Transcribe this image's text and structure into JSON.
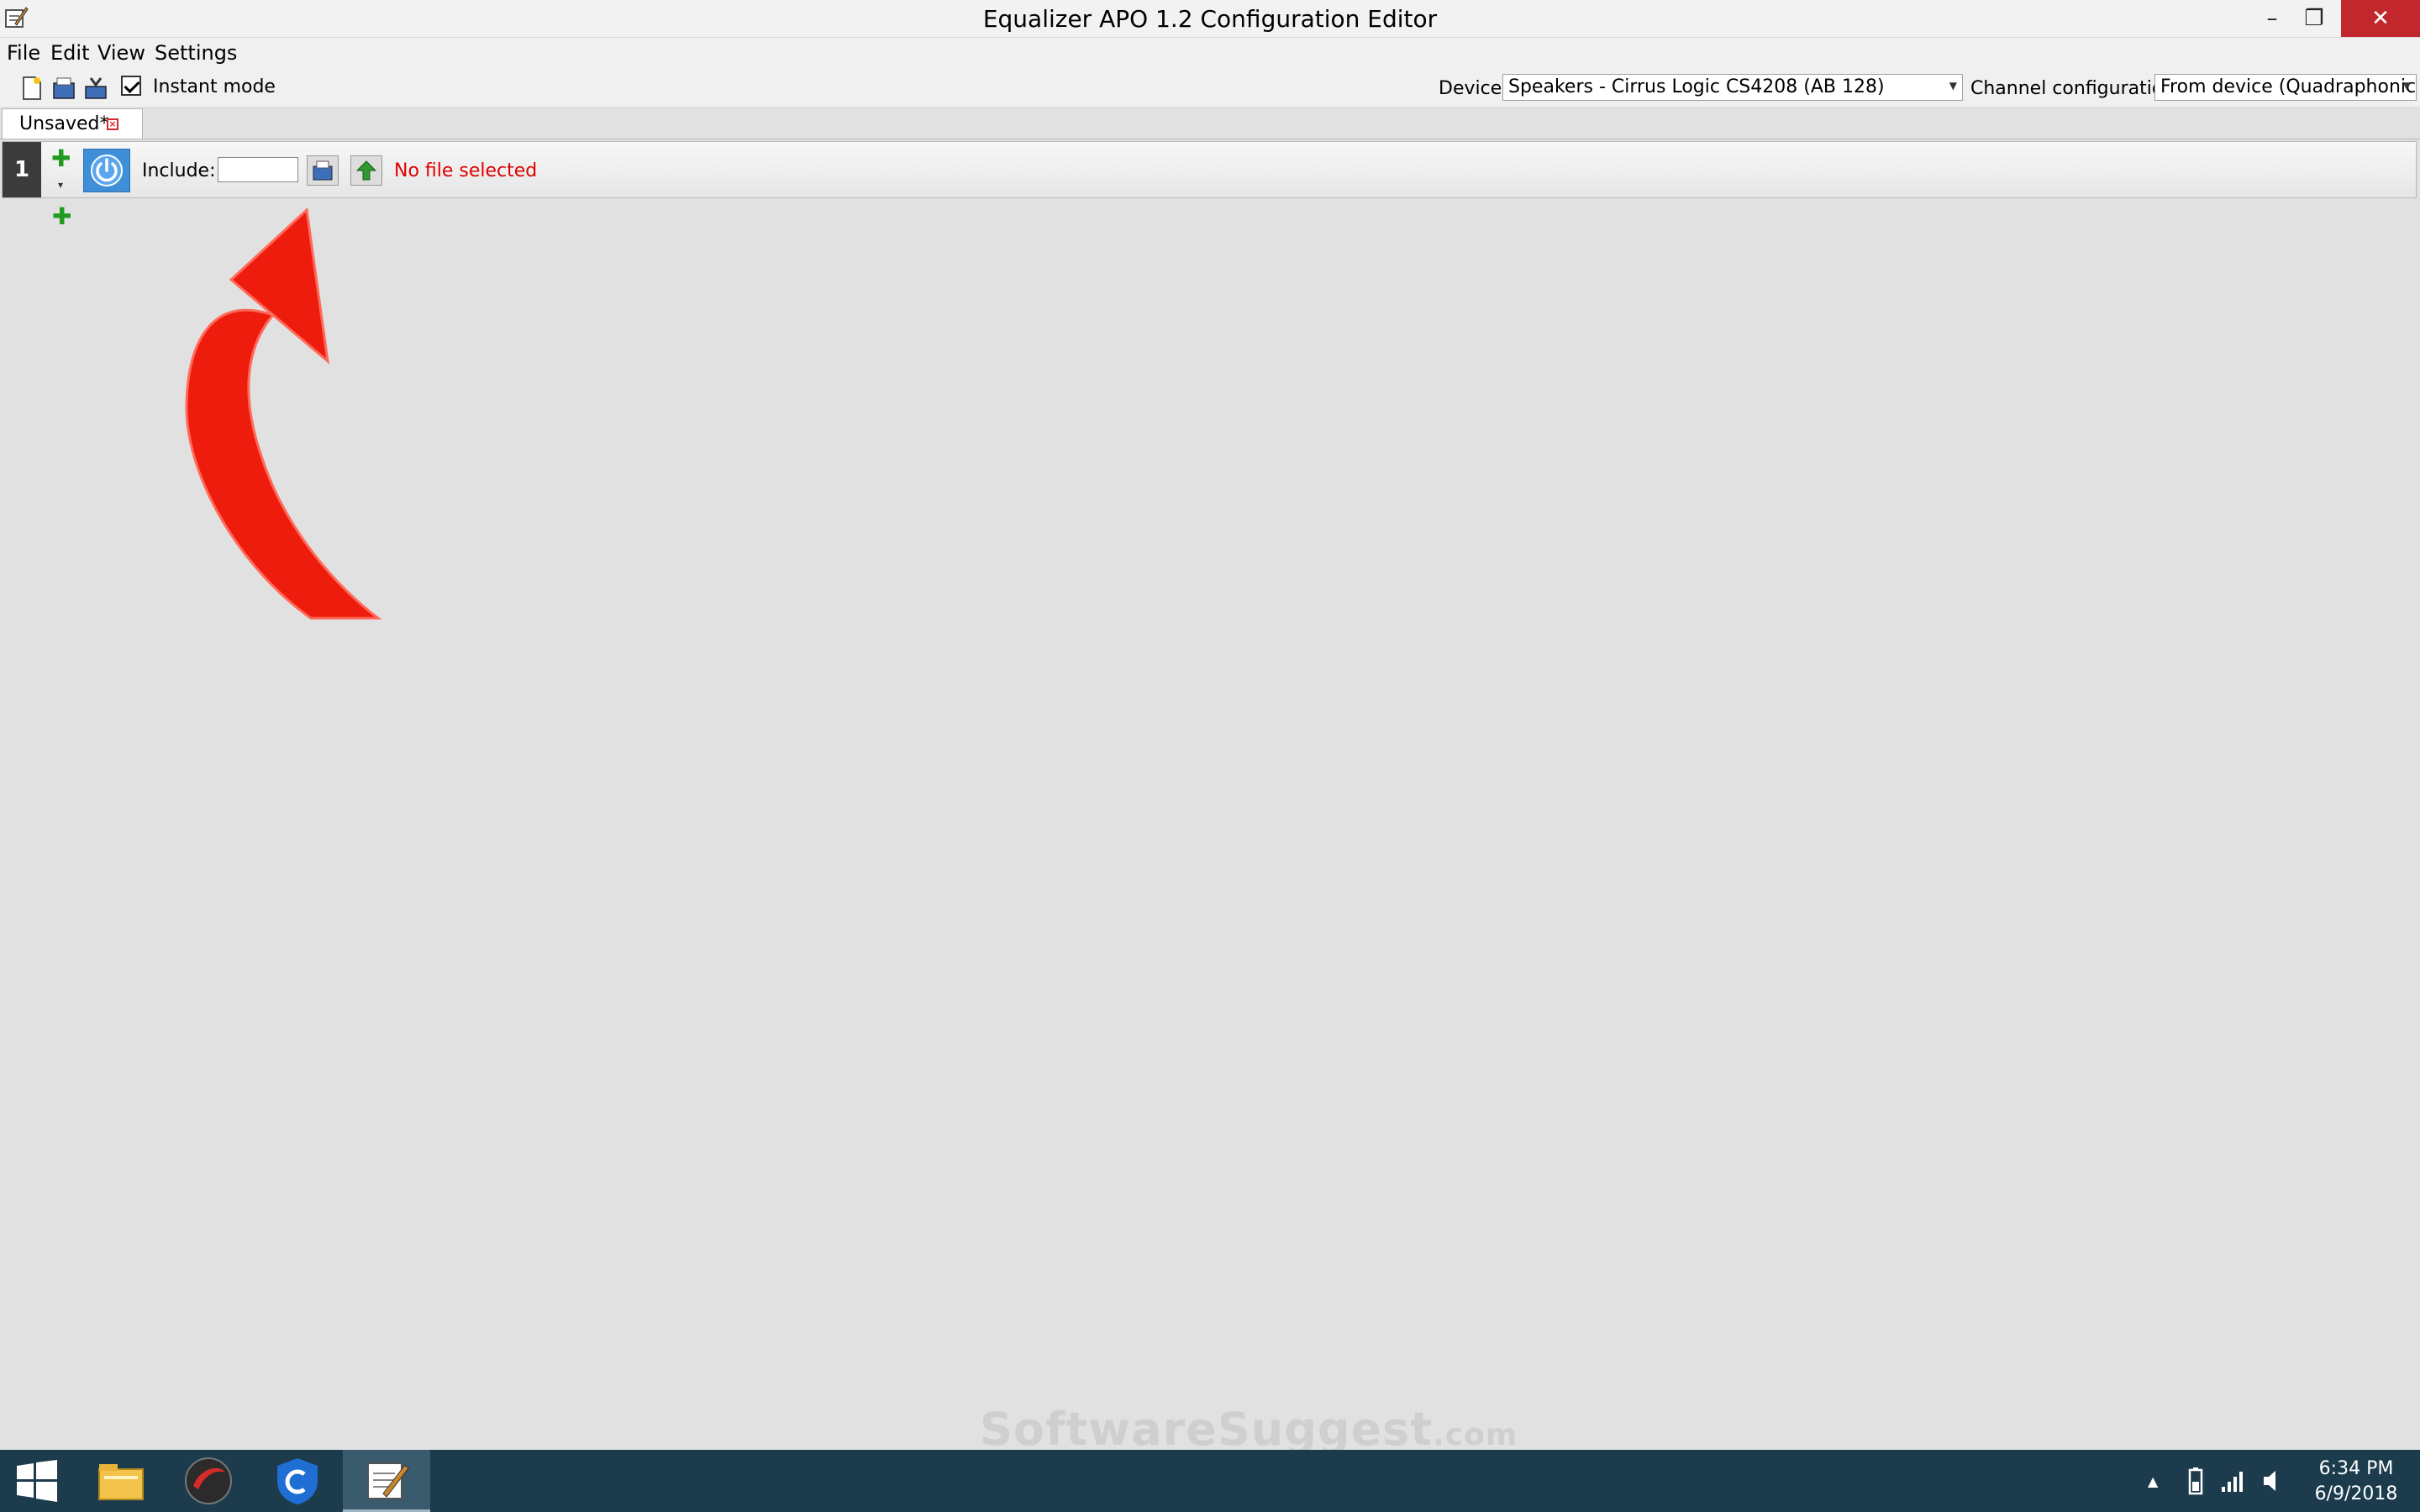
{
  "window": {
    "title": "Equalizer APO 1.2 Configuration Editor",
    "minimize_glyph": "–",
    "maximize_glyph": "❐",
    "close_glyph": "✕"
  },
  "menu": {
    "items": [
      "File",
      "Edit",
      "View",
      "Settings"
    ]
  },
  "toolbar": {
    "instant_mode_label": "Instant mode",
    "instant_mode_checked": true,
    "device_label": "Device:",
    "device_value": "Speakers - Cirrus Logic CS4208 (AB 128)",
    "channel_label": "Channel configuration:",
    "channel_value": "From device (Quadraphonic)"
  },
  "tabs": [
    {
      "label": "Unsaved*",
      "active": true
    }
  ],
  "filter_row": {
    "number": "1",
    "include_label": "Include:",
    "include_value": "",
    "status": "No file selected",
    "power_on": true
  },
  "watermark": {
    "text": "SoftwareSuggest",
    "suffix": ".com"
  },
  "taskbar": {
    "time": "6:34 PM",
    "date": "6/9/2018",
    "tray_up_glyph": "▲",
    "apps": [
      "start-icon",
      "file-explorer-icon",
      "antivirus-icon",
      "security-shield-icon",
      "editor-icon"
    ]
  },
  "colors": {
    "accent_blue": "#3f8fd8",
    "status_red": "#e00000",
    "annotation_arrow_red": "#ee1c0c",
    "taskbar": "#1c3c4e",
    "close_red": "#c1272d",
    "add_green": "#1f9b1f"
  }
}
